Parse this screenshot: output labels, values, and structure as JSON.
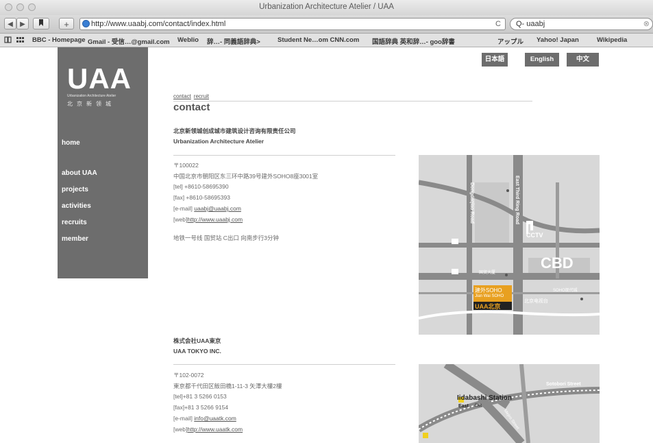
{
  "window": {
    "title": "Urbanization Architecture Atelier / UAA"
  },
  "toolbar": {
    "back_label": "◀",
    "forward_label": "▶",
    "add_label": "+",
    "url": "http://www.uaabj.com/contact/index.html",
    "reload_label": "C",
    "search_value": "Q- uaabj",
    "search_clear": "⊗"
  },
  "bookmarks": [
    "BBC - Homepage",
    "Gmail - 受信…@gmail.com",
    "Weblio",
    "辞…- 同義語辞典>",
    "Student Ne…om CNN.com",
    "国語辞典 英和辞…- goo辞書",
    "アップル",
    "Yahoo! Japan",
    "Wikipedia"
  ],
  "sidebar": {
    "logo": "UAA",
    "logo_sub": "Urbanization Architecture Atelier",
    "logo_cn": "北京新领城",
    "nav": [
      "home",
      "about UAA",
      "projects",
      "activities",
      "recruits",
      "member"
    ]
  },
  "lang": [
    "日本語",
    "English",
    "中文"
  ],
  "breadcrumb": [
    "contact",
    "recruit"
  ],
  "page_title": "contact",
  "office1": {
    "name_cn": "北京新领城创成城市建筑设计咨询有限责任公司",
    "name_en": "Urbanization Architecture Atelier",
    "postal": "〒100022",
    "address": "中国北京市朝阳区东三环中路39号建外SOHO8座3001室",
    "tel": "[tel] +8610-58695390",
    "fax": "[fax] +8610-58695393",
    "email_label": "[e-mail]",
    "email": "uaabj@uaabj.com",
    "web_label": "[web]",
    "web": "http://www.uaabj.com",
    "access": "地铁一号线 国贸站 C出口 向南步行3分钟"
  },
  "office2": {
    "name_jp": "株式会社UAA東京",
    "name_en": "UAA TOKYO INC.",
    "postal": "〒102-0072",
    "address": "東京都千代田区飯田橋1-11-3 矢澤大樓2樓",
    "tel": "[tel]+81 3 5266 0153",
    "fax": "[fax]+81 3 5266 9154",
    "email_label": "[e-mail]",
    "email": "info@uaatk.com",
    "web_label": "[web]",
    "web": "http://www.uaatk.com"
  },
  "map1": {
    "road1": "Dongdaqiao Road",
    "road2": "East Third Ring Road",
    "label_cctv": "CCTV",
    "label_cbd": "CBD",
    "soho_cn": "建外SOHO",
    "soho_en": "Jian Wai SOHO",
    "uaa_label": "UAA北京",
    "poi1": "北京电视台",
    "poi2": "SOHO现代城",
    "poi3": "国贸大厦"
  },
  "map2": {
    "station": "Iidabashi Station",
    "east": "East",
    "exit": "Exit",
    "street": "Sotobori Street",
    "avenue": "Mejiro Street"
  },
  "colors": {
    "sidebar": "#6d6d6d",
    "accent_soho": "#e8a020",
    "map_bg": "#cfcfcf"
  }
}
